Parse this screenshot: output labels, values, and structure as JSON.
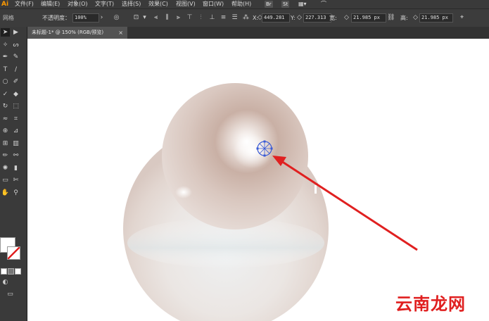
{
  "app": {
    "logo": "Ai"
  },
  "menu": {
    "items": [
      "文件(F)",
      "编辑(E)",
      "对象(O)",
      "文字(T)",
      "选择(S)",
      "效果(C)",
      "视图(V)",
      "窗口(W)",
      "帮助(H)"
    ],
    "badges": [
      "Br",
      "St"
    ]
  },
  "control": {
    "left_label": "网格",
    "opacity_label": "不透明度：",
    "opacity_value": "100%",
    "x_label": "X:",
    "x_value": "449.281",
    "y_label": "Y:",
    "y_value": "227.313",
    "w_label": "宽:",
    "w_value": "21.985 px",
    "h_label": "高:",
    "h_value": "21.985 px"
  },
  "document": {
    "tab_title": "未标题-1* @ 150% (RGB/预览)",
    "close_glyph": "×"
  },
  "tools": [
    {
      "name": "selection-tool-icon",
      "glyph": "➤"
    },
    {
      "name": "direct-selection-tool-icon",
      "glyph": "▶"
    },
    {
      "name": "magic-wand-tool-icon",
      "glyph": "✧"
    },
    {
      "name": "lasso-tool-icon",
      "glyph": "ᔕ"
    },
    {
      "name": "pen-tool-icon",
      "glyph": "✒"
    },
    {
      "name": "curvature-tool-icon",
      "glyph": "✎"
    },
    {
      "name": "type-tool-icon",
      "glyph": "T"
    },
    {
      "name": "line-tool-icon",
      "glyph": "/"
    },
    {
      "name": "ellipse-tool-icon",
      "glyph": "○"
    },
    {
      "name": "paintbrush-tool-icon",
      "glyph": "✐"
    },
    {
      "name": "shaper-tool-icon",
      "glyph": "✓"
    },
    {
      "name": "eraser-tool-icon",
      "glyph": "◆"
    },
    {
      "name": "rotate-tool-icon",
      "glyph": "↻"
    },
    {
      "name": "scale-tool-icon",
      "glyph": "⬚"
    },
    {
      "name": "width-tool-icon",
      "glyph": "≈"
    },
    {
      "name": "free-transform-tool-icon",
      "glyph": "⌗"
    },
    {
      "name": "shape-builder-tool-icon",
      "glyph": "⊕"
    },
    {
      "name": "perspective-grid-tool-icon",
      "glyph": "⊿"
    },
    {
      "name": "mesh-tool-icon",
      "glyph": "⊞"
    },
    {
      "name": "gradient-tool-icon",
      "glyph": "▥"
    },
    {
      "name": "eyedropper-tool-icon",
      "glyph": "✏"
    },
    {
      "name": "blend-tool-icon",
      "glyph": "⚯"
    },
    {
      "name": "symbol-sprayer-tool-icon",
      "glyph": "✺"
    },
    {
      "name": "column-graph-tool-icon",
      "glyph": "▮"
    },
    {
      "name": "artboard-tool-icon",
      "glyph": "▭"
    },
    {
      "name": "slice-tool-icon",
      "glyph": "✄"
    },
    {
      "name": "hand-tool-icon",
      "glyph": "✋"
    },
    {
      "name": "zoom-tool-icon",
      "glyph": "⚲"
    }
  ],
  "watermark": "云南龙网",
  "colors": {
    "accent_red": "#e01f1f",
    "canvas": "#ffffff",
    "chrome": "#3a3a3a"
  }
}
